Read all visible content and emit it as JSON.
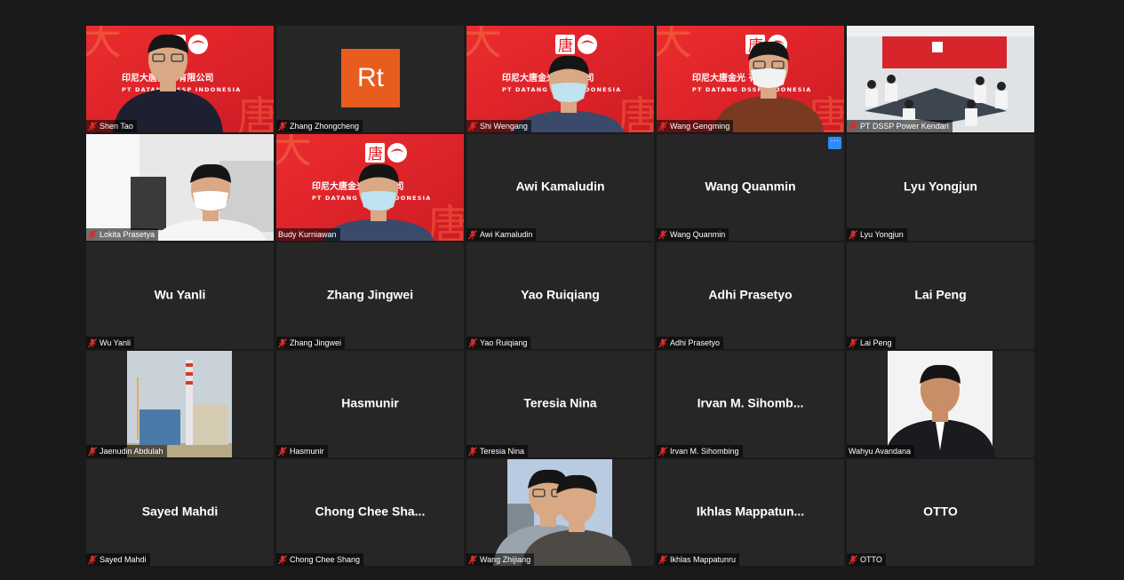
{
  "meeting": {
    "colors": {
      "background": "#1a1a1a",
      "tile": "#262626",
      "active_speaker_border": "#e8f061",
      "mute_icon": "#e02828",
      "brand_red": "#e3202a"
    },
    "participants": [
      {
        "name": "Shen Tao",
        "video": "company-banner-man-glasses",
        "muted": true
      },
      {
        "name": "Zhang Zhongcheng",
        "avatar_text": "Rt",
        "avatar_color": "#e85d1e",
        "muted": true
      },
      {
        "name": "Shi Wengang",
        "video": "company-banner-man-mask",
        "muted": true
      },
      {
        "name": "Wang Gengming",
        "video": "company-banner-man-mask-glasses",
        "muted": true
      },
      {
        "name": "PT DSSP Power Kendari",
        "video": "conference-room",
        "muted": true
      },
      {
        "name": "Lokita Prasetya",
        "video": "office-man-mask",
        "muted": true
      },
      {
        "name": "Budy Kurniawan",
        "video": "company-banner-man-mask",
        "muted": false,
        "active_speaker": true
      },
      {
        "name": "Awi Kamaludin",
        "display": "Awi Kamaludin",
        "muted": true
      },
      {
        "name": "Wang Quanmin",
        "display": "Wang Quanmin",
        "muted": true,
        "menu": "···"
      },
      {
        "name": "Lyu Yongjun",
        "display": "Lyu Yongjun",
        "muted": true
      },
      {
        "name": "Wu Yanli",
        "display": "Wu Yanli",
        "muted": true
      },
      {
        "name": "Zhang Jingwei",
        "display": "Zhang Jingwei",
        "muted": true
      },
      {
        "name": "Yao Ruiqiang",
        "display": "Yao Ruiqiang",
        "muted": true
      },
      {
        "name": "Adhi Prasetyo",
        "display": "Adhi Prasetyo",
        "muted": true
      },
      {
        "name": "Lai Peng",
        "display": "Lai Peng",
        "muted": true
      },
      {
        "name": "Jaenudin Abdulah",
        "video": "power-plant-chimney",
        "muted": true
      },
      {
        "name": "Hasmunir",
        "display": "Hasmunir",
        "muted": true
      },
      {
        "name": "Teresia Nina",
        "display": "Teresia Nina",
        "muted": true
      },
      {
        "name": "Irvan M. Sihombing",
        "display": "Irvan M. Sihomb...",
        "muted": true
      },
      {
        "name": "Wahyu Avandana",
        "video": "portrait-man-suit",
        "muted": false
      },
      {
        "name": "Sayed Mahdi",
        "display": "Sayed Mahdi",
        "muted": true
      },
      {
        "name": "Chong Chee Shang",
        "display": "Chong Chee Sha...",
        "muted": true
      },
      {
        "name": "Wang Zhijiang",
        "video": "couple-photo",
        "muted": true
      },
      {
        "name": "Ikhlas Mappatunru",
        "display": "Ikhlas Mappatun...",
        "muted": true
      },
      {
        "name": "OTTO",
        "display": "OTTO",
        "muted": true
      }
    ],
    "banner_text": {
      "cn": "印尼大唐金光 有限公司",
      "en": "PT DATANG DSSP INDONESIA",
      "logo_char": "唐",
      "big_char": "大"
    }
  }
}
